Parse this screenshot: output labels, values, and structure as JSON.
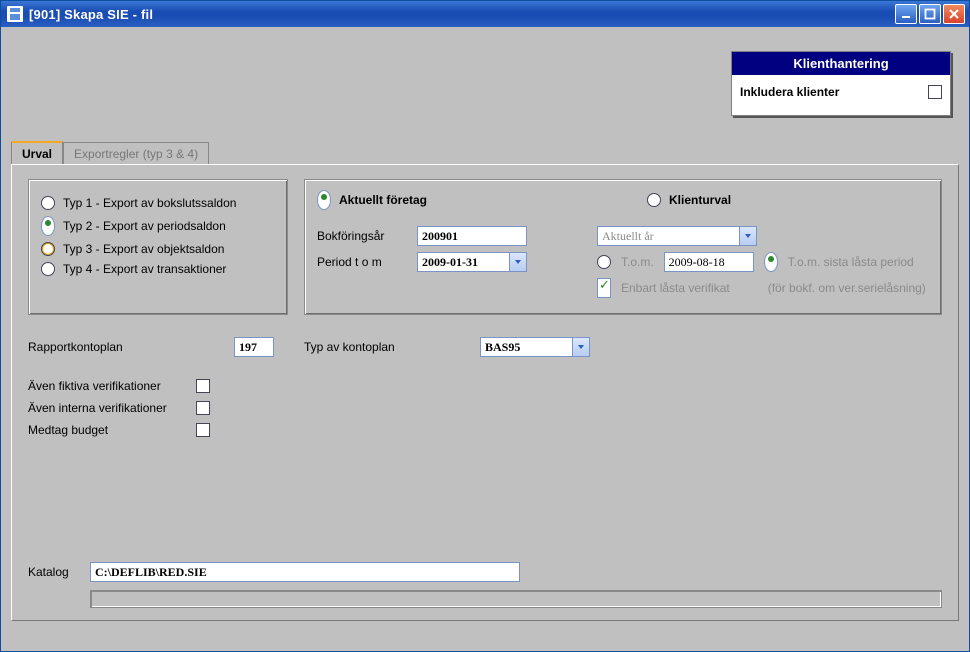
{
  "window": {
    "title": "[901]  Skapa SIE - fil"
  },
  "klient": {
    "heading": "Klienthantering",
    "include_label": "Inkludera klienter",
    "include_checked": false
  },
  "tabs": {
    "active": "Urval",
    "items": [
      {
        "label": "Urval"
      },
      {
        "label": "Exportregler (typ 3 & 4)"
      }
    ]
  },
  "types": {
    "selected": 1,
    "items": [
      "Typ 1 - Export av bokslutssaldon",
      "Typ 2 - Export av periodsaldon",
      "Typ 3 - Export av objektsaldon",
      "Typ 4 - Export av transaktioner"
    ]
  },
  "scope": {
    "aktuellt_label": "Aktuellt företag",
    "klienturval_label": "Klienturval",
    "selected": "aktuellt",
    "bokforingsar_label": "Bokföringsår",
    "bokforingsar_value": "200901",
    "period_label": "Period t o m",
    "period_value": "2009-01-31",
    "ar_select": "Aktuellt år",
    "tom_label": "T.o.m.",
    "tom_value": "2009-08-18",
    "tom_sista_label": "T.o.m. sista låsta period",
    "tom_selected": "sista",
    "enbart_label": "Enbart låsta verifikat",
    "enbart_checked": true,
    "enbart_note": "(för bokf. om ver.serielåsning)"
  },
  "rapport": {
    "label": "Rapportkontoplan",
    "value": "197",
    "typ_label": "Typ av kontoplan",
    "typ_value": "BAS95"
  },
  "options": {
    "fiktiva_label": "Även fiktiva verifikationer",
    "fiktiva_checked": false,
    "interna_label": "Även interna verifikationer",
    "interna_checked": false,
    "budget_label": "Medtag budget",
    "budget_checked": false
  },
  "katalog": {
    "label": "Katalog",
    "value": "C:\\DEFLIB\\RED.SIE"
  }
}
